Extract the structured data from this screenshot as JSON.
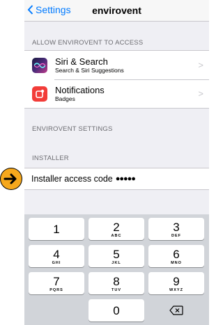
{
  "nav": {
    "back_label": "Settings",
    "title": "envirovent"
  },
  "sections": {
    "allow_header": "ALLOW ENVIROVENT TO ACCESS",
    "settings_header": "ENVIROVENT SETTINGS",
    "installer_header": "INSTALLER"
  },
  "access_rows": [
    {
      "title": "Siri & Search",
      "subtitle": "Search & Siri Suggestions",
      "icon": "siri-icon"
    },
    {
      "title": "Notifications",
      "subtitle": "Badges",
      "icon": "notifications-icon"
    }
  ],
  "installer": {
    "label": "Installer access code",
    "value": "●●●●●"
  },
  "keypad": [
    {
      "num": "1",
      "letters": ""
    },
    {
      "num": "2",
      "letters": "ABC"
    },
    {
      "num": "3",
      "letters": "DEF"
    },
    {
      "num": "4",
      "letters": "GHI"
    },
    {
      "num": "5",
      "letters": "JKL"
    },
    {
      "num": "6",
      "letters": "MNO"
    },
    {
      "num": "7",
      "letters": "PQRS"
    },
    {
      "num": "8",
      "letters": "TUV"
    },
    {
      "num": "9",
      "letters": "WXYZ"
    },
    {
      "num": "0",
      "letters": ""
    }
  ],
  "colors": {
    "accent": "#007aff",
    "arrow": "#f6a81d",
    "notification": "#f23c38"
  }
}
